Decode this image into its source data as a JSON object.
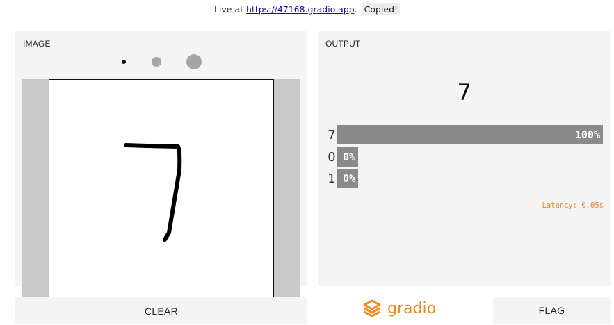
{
  "topbar": {
    "live_prefix": "Live at ",
    "url": "https://47168.gradio.app",
    "url_suffix": ".",
    "copied_label": "Copied!"
  },
  "input": {
    "title": "IMAGE",
    "brush_sizes": [
      "small",
      "medium",
      "large"
    ],
    "selected_brush": "small",
    "clear_label": "CLEAR"
  },
  "output": {
    "title": "OUTPUT",
    "predicted_label": "7",
    "confidences": [
      {
        "label": "7",
        "value": 1.0,
        "pct_text": "100%"
      },
      {
        "label": "0",
        "value": 0.0,
        "pct_text": "0%"
      },
      {
        "label": "1",
        "value": 0.0,
        "pct_text": "0%"
      }
    ],
    "latency_text": "Latency: 0.05s",
    "flag_label": "FLAG"
  },
  "brand": {
    "name": "gradio",
    "icon": "gradio-logo-icon",
    "color": "#f08a24"
  },
  "colors": {
    "bar": "#8a8a8a",
    "latency": "#e8872b",
    "link": "#1a0dab"
  }
}
